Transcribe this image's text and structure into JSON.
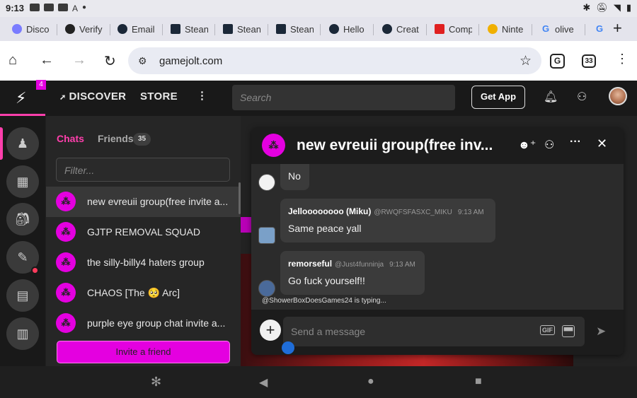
{
  "status_bar": {
    "time": "9:13",
    "right_icons": [
      "bluetooth-icon",
      "mute-icon",
      "wifi-icon",
      "battery-icon"
    ]
  },
  "tabs": [
    {
      "label": "Disco",
      "fav_color": "#7a7cff"
    },
    {
      "label": "Verify",
      "fav_color": "#222222"
    },
    {
      "label": "Email",
      "fav_color": "#1b2838"
    },
    {
      "label": "Stean",
      "fav_color": "#1b2838"
    },
    {
      "label": "Stean",
      "fav_color": "#1b2838"
    },
    {
      "label": "Stean",
      "fav_color": "#1b2838"
    },
    {
      "label": "Hello",
      "fav_color": "#1b2838"
    },
    {
      "label": "Creat",
      "fav_color": "#1b2838"
    },
    {
      "label": "Comp",
      "fav_color": "#e02020"
    },
    {
      "label": "Ninte",
      "fav_color": "#f0b000"
    },
    {
      "label": "olive",
      "fav_color": "#4285f4"
    },
    {
      "label": "",
      "fav_color": "#4285f4"
    }
  ],
  "toolbar": {
    "url": "gamejolt.com",
    "tab_count": "33",
    "translate_icon": "translate-icon"
  },
  "gj": {
    "notif_count": "4",
    "nav_discover": "DISCOVER",
    "nav_store": "STORE",
    "search_placeholder": "Search",
    "get_app": "Get App"
  },
  "chat_sidebar": {
    "tab_chats": "Chats",
    "tab_friends": "Friends",
    "friends_count": "35",
    "filter_placeholder": "Filter...",
    "chats": [
      {
        "name": "new evreuii group(free invite a...",
        "active": true
      },
      {
        "name": "GJTP REMOVAL SQUAD",
        "active": false
      },
      {
        "name": "the silly-billy4 haters group",
        "active": false
      },
      {
        "name": "CHAOS [The 🥺 Arc]",
        "active": false
      },
      {
        "name": "purple eye group chat invite a...",
        "active": false
      }
    ],
    "invite_button": "Invite a friend"
  },
  "chat_window": {
    "title": "new evreuii group(free inv...",
    "messages": [
      {
        "author": "",
        "handle": "",
        "time": "",
        "text": "No"
      },
      {
        "author": "Jelloooooooo (Miku)",
        "handle": "@RWQFSFASXC_MIKU",
        "time": "9:13 AM",
        "text": "Same peace yall"
      },
      {
        "author": "remorseful",
        "handle": "@Just4funninja",
        "time": "9:13 AM",
        "text": "Go fuck yourself!!"
      }
    ],
    "typing": "@ShowerBoxDoesGames24 is typing...",
    "input_placeholder": "Send a message",
    "gif_label": "GIF"
  }
}
